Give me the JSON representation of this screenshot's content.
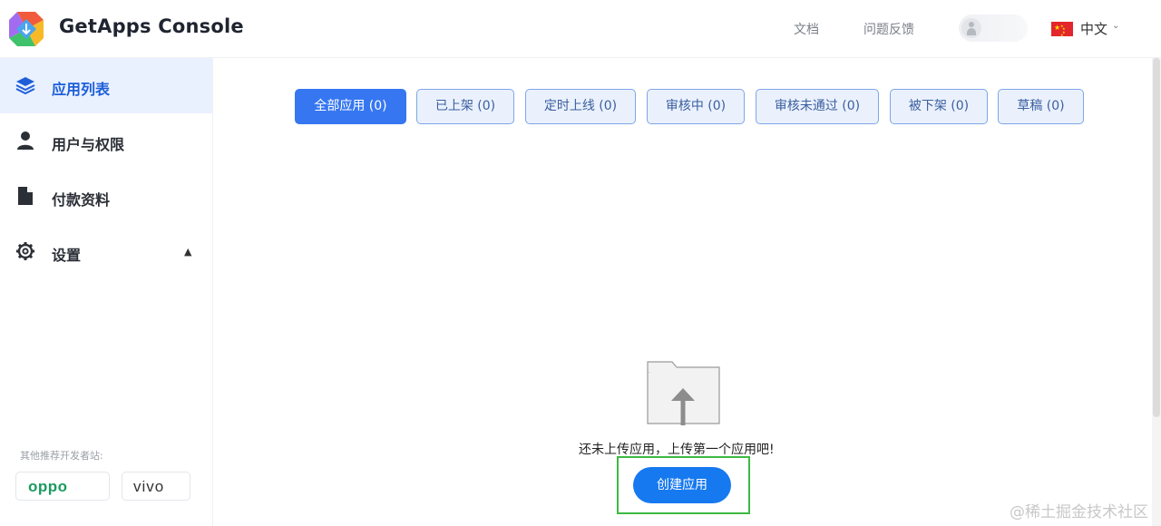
{
  "header": {
    "title": "GetApps Console",
    "links": {
      "docs": "文档",
      "feedback": "问题反馈"
    },
    "language": "中文",
    "language_flag": "china-flag-icon"
  },
  "sidebar": {
    "items": [
      {
        "label": "应用列表",
        "icon": "layers-icon",
        "active": true
      },
      {
        "label": "用户与权限",
        "icon": "user-icon",
        "active": false
      },
      {
        "label": "付款资料",
        "icon": "document-icon",
        "active": false
      },
      {
        "label": "设置",
        "icon": "gear-icon",
        "active": false
      }
    ],
    "recommend_label": "其他推荐开发者站:",
    "partners": [
      "oppo",
      "vivo"
    ]
  },
  "tabs": [
    {
      "label": "全部应用 (0)",
      "active": true
    },
    {
      "label": "已上架 (0)",
      "active": false
    },
    {
      "label": "定时上线 (0)",
      "active": false
    },
    {
      "label": "审核中 (0)",
      "active": false
    },
    {
      "label": "审核未通过 (0)",
      "active": false
    },
    {
      "label": "被下架 (0)",
      "active": false
    },
    {
      "label": "草稿 (0)",
      "active": false
    }
  ],
  "empty_state": {
    "message": "还未上传应用，上传第一个应用吧!",
    "create_button": "创建应用"
  },
  "watermark": "@稀土掘金技术社区",
  "colors": {
    "primary": "#3677f1",
    "button": "#1779f0",
    "active_nav_bg": "#e9f1ff",
    "tab_bg": "#eaf1fc",
    "highlight_border": "#3cb943"
  }
}
